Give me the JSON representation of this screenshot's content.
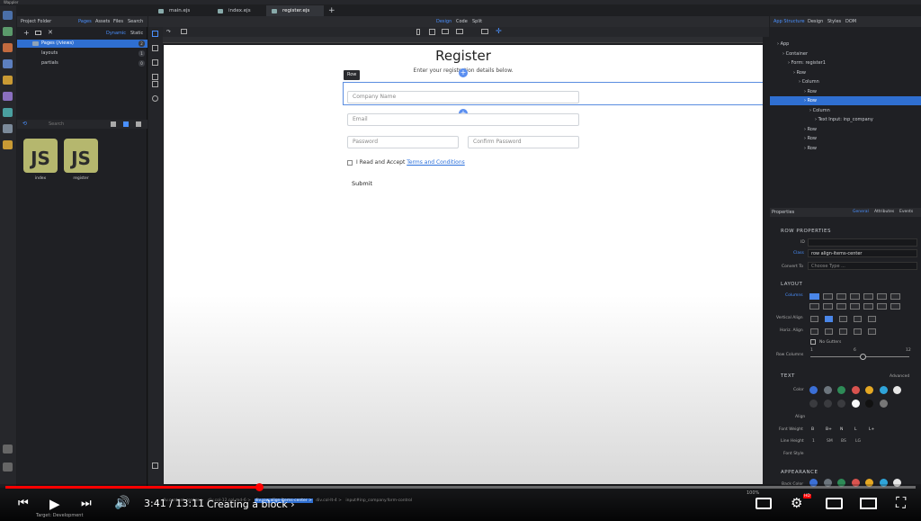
{
  "window": {
    "title": "Wappler"
  },
  "tabs": [
    {
      "label": "main.ejs",
      "active": false
    },
    {
      "label": "index.ejs",
      "active": false
    },
    {
      "label": "register.ejs",
      "active": true
    }
  ],
  "view_modes": [
    "Design",
    "Code",
    "Split"
  ],
  "left_panel": {
    "title": "Project Folder",
    "tabs": [
      "Pages",
      "Assets",
      "Files",
      "Search"
    ],
    "mode": [
      "Dynamic",
      "Static"
    ],
    "tree": [
      {
        "label": "Pages (/views)",
        "badge": "2",
        "selected": true
      },
      {
        "label": "layouts",
        "badge": "1",
        "selected": false
      },
      {
        "label": "partials",
        "badge": "0",
        "selected": false
      }
    ],
    "search_placeholder": "Search",
    "files": [
      {
        "icon_text": "JS",
        "label": "index"
      },
      {
        "icon_text": "JS",
        "label": "register"
      }
    ]
  },
  "page": {
    "title": "Register",
    "subtitle": "Enter your registration details below.",
    "row_badge": "Row",
    "fields": {
      "company": "Company Name",
      "email": "Email",
      "password": "Password",
      "confirm": "Confirm Password"
    },
    "accept_prefix": "I Read and Accept ",
    "accept_link": "Terms and Conditions",
    "submit": "Submit"
  },
  "right_panel": {
    "tabs": [
      "App Structure",
      "Design",
      "Styles",
      "DOM"
    ],
    "structure": [
      {
        "label": "App",
        "indent": 0,
        "selected": false
      },
      {
        "label": "Container",
        "indent": 1,
        "selected": false
      },
      {
        "label": "Form: register1",
        "indent": 2,
        "selected": false
      },
      {
        "label": "Row",
        "indent": 3,
        "selected": false
      },
      {
        "label": "Column",
        "indent": 4,
        "selected": false
      },
      {
        "label": "Row",
        "indent": 5,
        "selected": false
      },
      {
        "label": "Row",
        "indent": 5,
        "selected": true
      },
      {
        "label": "Column",
        "indent": 6,
        "selected": false
      },
      {
        "label": "Text Input: inp_company",
        "indent": 7,
        "selected": false
      },
      {
        "label": "Row",
        "indent": 5,
        "selected": false
      },
      {
        "label": "Row",
        "indent": 5,
        "selected": false
      },
      {
        "label": "Row",
        "indent": 5,
        "selected": false
      }
    ],
    "properties_title": "Properties",
    "prop_tabs": [
      "General",
      "Attributes",
      "Events"
    ],
    "row_properties": "ROW PROPERTIES",
    "id_label": "ID",
    "class_label": "Class",
    "class_value": "row align-items-center",
    "convert_label": "Convert To",
    "convert_placeholder": "Choose Type ...",
    "layout_title": "LAYOUT",
    "columns_label": "Columns",
    "valign_label": "Vertical Align",
    "halign_label": "Horiz. Align",
    "no_gutters": "No Gutters",
    "row_columns_label": "Row Columns",
    "slider_min": "1",
    "slider_mid": "6",
    "slider_max": "12",
    "text_title": "TEXT",
    "advanced_label": "Advanced",
    "color_label": "Color",
    "align_label": "Align",
    "font_weight_label": "Font Weight",
    "font_weights": [
      "B",
      "B+",
      "N",
      "L",
      "L+"
    ],
    "line_height_label": "Line Height",
    "line_heights": [
      "1",
      "SM",
      "BS",
      "LG"
    ],
    "font_style_label": "Font Style",
    "appearance_title": "APPEARANCE",
    "back_color_label": "Back Color",
    "colors": [
      "#3b6fd6",
      "#6c757d",
      "#2e8b57",
      "#d9534f",
      "#e5a823",
      "#2fa4d9",
      "#e6e6e6"
    ],
    "colors_row2": [
      "#3a3b3f",
      "#3a3b3f",
      "#3a3b3f",
      "#f8f9fa",
      "#111111",
      "#777777"
    ]
  },
  "status": {
    "zoom": "100%",
    "breadcrumb": [
      "div.content-center",
      "div.col-12.col-md-6",
      "div.row.align-items-center",
      "div.col-lt-4",
      "input#inp_company.form-control"
    ],
    "target": "Target: Development"
  },
  "video": {
    "time": "3:41 / 13:11",
    "chapter": "Creating a block",
    "progress": 0.279,
    "hd_badge": "HD",
    "accent": "#ff0000"
  }
}
